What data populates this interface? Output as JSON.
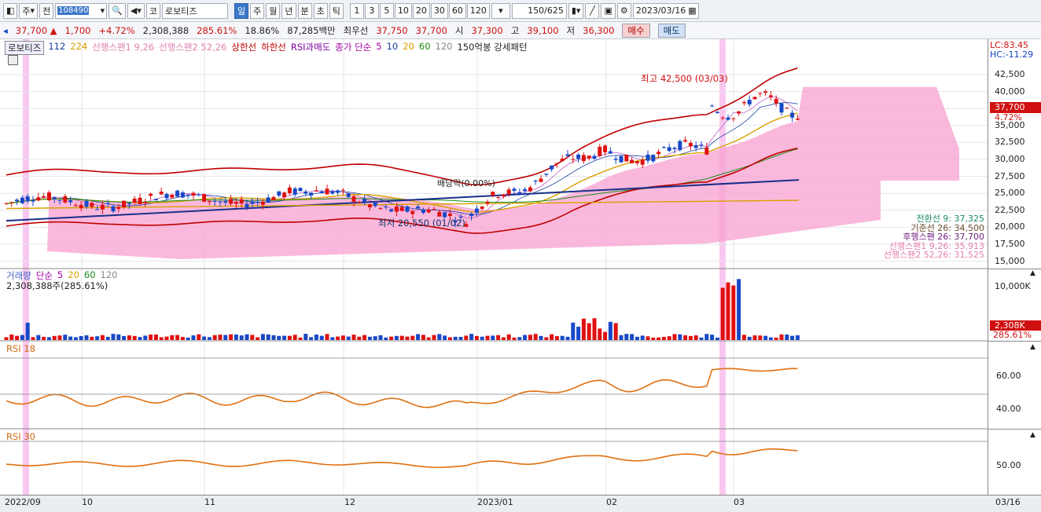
{
  "toolbar": {
    "period_label": "주",
    "prev_label": "전",
    "code": "108490",
    "market_label": "코",
    "stock_name": "로보티즈",
    "period_buttons": [
      "일",
      "주",
      "월",
      "년",
      "분",
      "초",
      "틱"
    ],
    "active_period": "일",
    "interval_buttons": [
      "1",
      "3",
      "5",
      "10",
      "20",
      "30",
      "60",
      "120"
    ],
    "bar_count": "150/625",
    "date": "2023/03/16"
  },
  "quote": {
    "price": "37,700",
    "change": "1,700",
    "change_pct": "+4.72%",
    "volume": "2,308,388",
    "volume_ratio": "285.61%",
    "turnover": "18.86%",
    "amount": "87,285백만",
    "bid_label": "최우선",
    "ask": "37,750",
    "bid": "37,700",
    "open_label": "시",
    "open": "37,300",
    "high_label": "고",
    "high": "39,100",
    "low_label": "저",
    "low": "36,300",
    "buy_label": "매수",
    "sell_label": "매도"
  },
  "legend": {
    "name": "로보티즈",
    "items": [
      {
        "label": "112",
        "color": "#1a3fa0"
      },
      {
        "label": "224",
        "color": "#d8a000"
      },
      {
        "label": "선행스팬1 9,26",
        "color": "#e080b0"
      },
      {
        "label": "선행스팬2 52,26",
        "color": "#e080b0"
      },
      {
        "label": "상한선",
        "color": "#c00000"
      },
      {
        "label": "하한선",
        "color": "#c00000"
      },
      {
        "label": "RSI과매도",
        "color": "#8000a0"
      },
      {
        "label": "종가 단순",
        "color": "#a000a0"
      },
      {
        "label": "5",
        "color": "#a000a0"
      },
      {
        "label": "10",
        "color": "#1a3fa0"
      },
      {
        "label": "20",
        "color": "#d8a000"
      },
      {
        "label": "60",
        "color": "#1a8a1a"
      },
      {
        "label": "120",
        "color": "#888888"
      },
      {
        "label": "150억봉 강세패턴",
        "color": "#222222"
      }
    ]
  },
  "price_axis": {
    "lc": "LC:83.45",
    "hc": "HC:-11.29",
    "ticks": [
      "42,500",
      "40,000",
      "37,500",
      "35,000",
      "32,500",
      "30,000",
      "27,500",
      "25,000",
      "22,500",
      "20,000",
      "17,500",
      "15,000"
    ],
    "current_price": "37,700",
    "current_pct": "4.72%"
  },
  "annotations": {
    "high": "최고 42,500 (03/03)",
    "low": "최저 20,550 (01/02)",
    "dividend": "배당락(0.00%)"
  },
  "ichimoku": [
    {
      "label": "전환선 9: 37,325",
      "color": "#1a8a6a"
    },
    {
      "label": "기준선 26: 34,500",
      "color": "#6a4a2a"
    },
    {
      "label": "후행스팬 26: 37,700",
      "color": "#702080"
    },
    {
      "label": "선행스팬1 9,26: 35,913",
      "color": "#e080b0"
    },
    {
      "label": "선행스팬2 52,26: 31,525",
      "color": "#e080b0"
    }
  ],
  "volume_pane": {
    "title": "거래량",
    "ma_label": "단순",
    "ma_items": [
      "5",
      "20",
      "60",
      "120"
    ],
    "value": "2,308,388주(285.61%)",
    "axis_tick": "10,000K",
    "current": "2,308K",
    "current_pct": "285.61%"
  },
  "rsi18": {
    "title": "RSI 18",
    "ticks": [
      "60.00",
      "40.00"
    ]
  },
  "rsi30": {
    "title": "RSI 30",
    "ticks": [
      "50.00"
    ]
  },
  "time_axis": {
    "labels": [
      "2022/09",
      "10",
      "11",
      "12",
      "2023/01",
      "02",
      "03"
    ],
    "right_label": "03/16"
  }
}
